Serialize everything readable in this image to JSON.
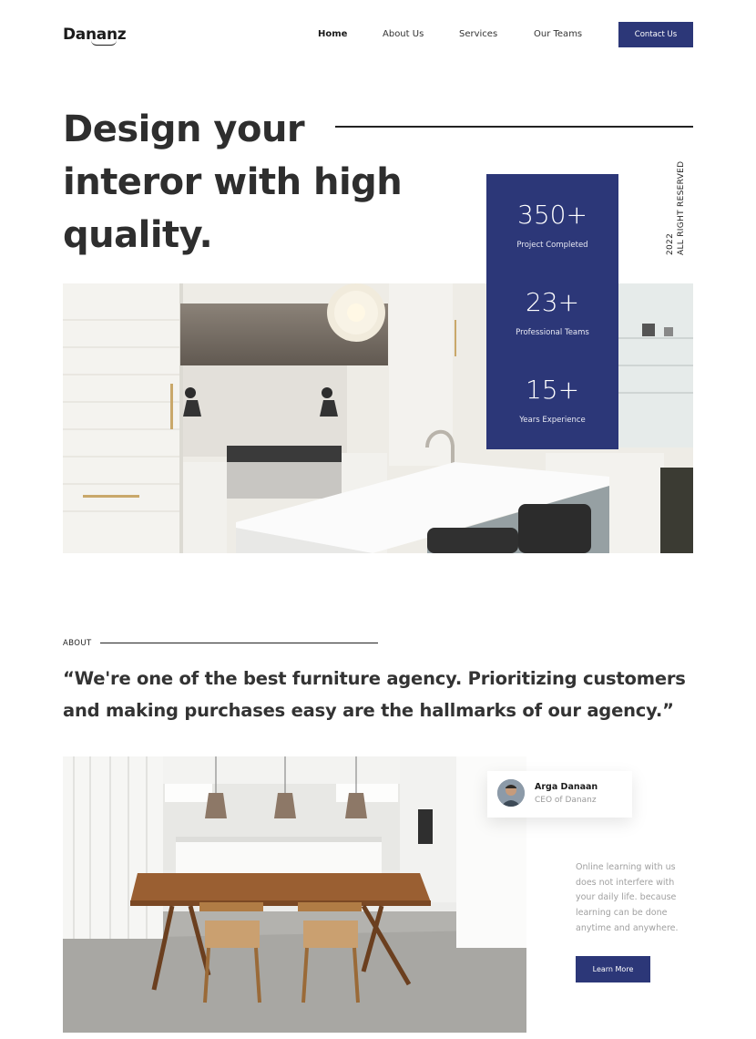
{
  "header": {
    "logo": "Dananz",
    "nav": [
      "Home",
      "About Us",
      "Services",
      "Our Teams"
    ],
    "contact_label": "Contact Us"
  },
  "hero": {
    "title": "Design your interor with high quality.",
    "vertical_year": "2022",
    "vertical_text": "ALL RIGHT RESERVED",
    "image_alt": "white kitchen with island and chandelier"
  },
  "stats": [
    {
      "value": "350+",
      "label": "Project Completed"
    },
    {
      "value": "23+",
      "label": "Professional Teams"
    },
    {
      "value": "15+",
      "label": "Years Experience"
    }
  ],
  "about": {
    "label": "ABOUT",
    "quote": "“We're one of the best furniture agency. Prioritizing customers and making purchases easy are the hallmarks of our agency.”",
    "ceo_name": "Arga Danaan",
    "ceo_title": "CEO of Dananz",
    "description": "Online learning with us does not interfere with your daily life. because learning can be done anytime and anywhere.",
    "button_label": "Learn More"
  },
  "colors": {
    "brand": "#2c3778",
    "text": "#2e2e2e",
    "muted": "#a0a0a0"
  }
}
